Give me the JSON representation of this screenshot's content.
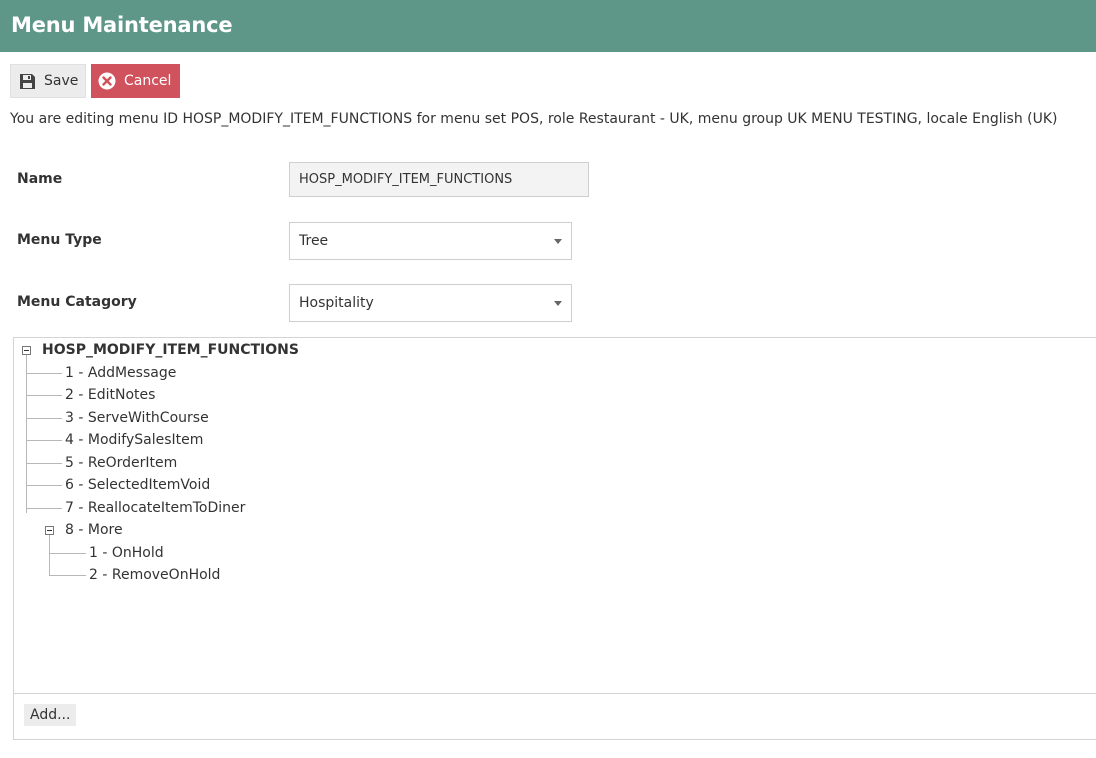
{
  "header": {
    "title": "Menu Maintenance"
  },
  "toolbar": {
    "save_label": "Save",
    "cancel_label": "Cancel"
  },
  "info_text": "You are editing menu ID HOSP_MODIFY_ITEM_FUNCTIONS for menu set POS, role Restaurant - UK, menu group UK MENU TESTING, locale English (UK)",
  "form": {
    "name_label": "Name",
    "name_value": "HOSP_MODIFY_ITEM_FUNCTIONS",
    "type_label": "Menu Type",
    "type_value": "Tree",
    "category_label": "Menu Catagory",
    "category_value": "Hospitality"
  },
  "tree": {
    "root": "HOSP_MODIFY_ITEM_FUNCTIONS",
    "items": [
      "1 - AddMessage",
      "2 - EditNotes",
      "3 - ServeWithCourse",
      "4 - ModifySalesItem",
      "5 - ReOrderItem",
      "6 - SelectedItemVoid",
      "7 - ReallocateItemToDiner",
      "8 - More"
    ],
    "sub_items": [
      "1 - OnHold",
      "2 - RemoveOnHold"
    ]
  },
  "add_label": "Add..."
}
